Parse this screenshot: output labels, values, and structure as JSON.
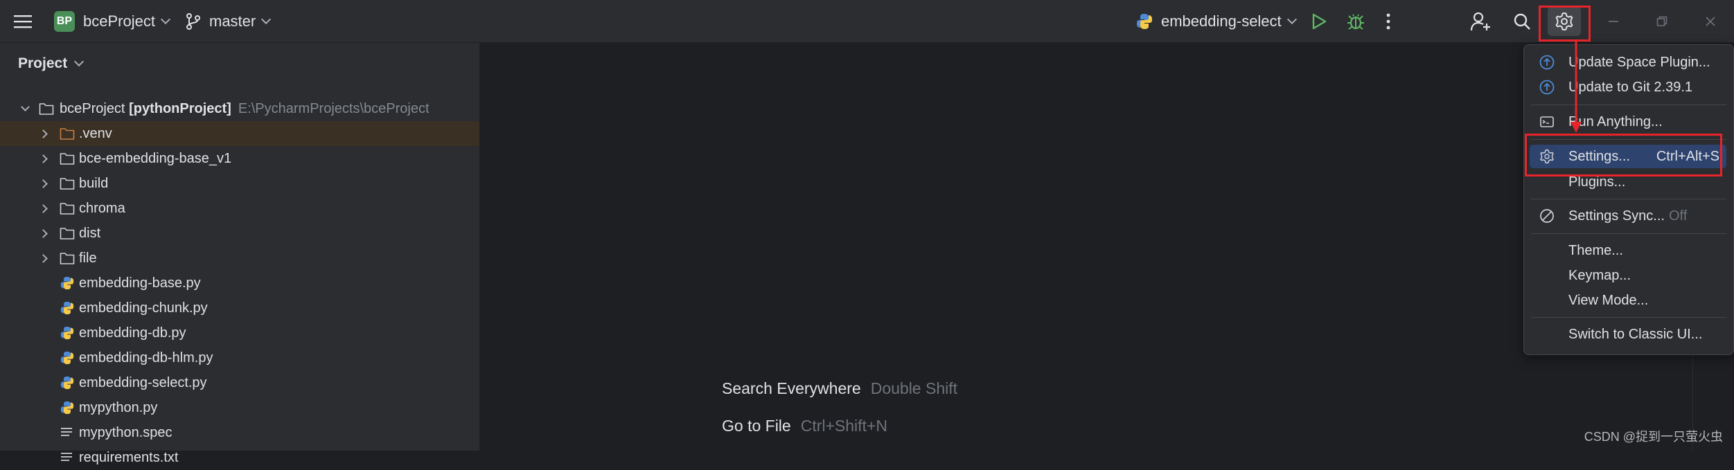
{
  "titlebar": {
    "project_badge": "BP",
    "project_name": "bceProject",
    "branch": "master",
    "run_config": "embedding-select"
  },
  "project_panel": {
    "header": "Project",
    "root": {
      "name": "bceProject",
      "module": "[pythonProject]",
      "path": "E:\\PycharmProjects\\bceProject"
    },
    "items": [
      {
        "label": ".venv",
        "kind": "folder-excluded"
      },
      {
        "label": "bce-embedding-base_v1",
        "kind": "folder"
      },
      {
        "label": "build",
        "kind": "folder"
      },
      {
        "label": "chroma",
        "kind": "folder"
      },
      {
        "label": "dist",
        "kind": "folder"
      },
      {
        "label": "file",
        "kind": "folder"
      },
      {
        "label": "embedding-base.py",
        "kind": "python"
      },
      {
        "label": "embedding-chunk.py",
        "kind": "python"
      },
      {
        "label": "embedding-db.py",
        "kind": "python"
      },
      {
        "label": "embedding-db-hlm.py",
        "kind": "python"
      },
      {
        "label": "embedding-select.py",
        "kind": "python"
      },
      {
        "label": "mypython.py",
        "kind": "python"
      },
      {
        "label": "mypython.spec",
        "kind": "text"
      },
      {
        "label": "requirements.txt",
        "kind": "text"
      }
    ]
  },
  "editor": {
    "hints": [
      {
        "action": "Search Everywhere",
        "shortcut": "Double Shift"
      },
      {
        "action": "Go to File",
        "shortcut": "Ctrl+Shift+N"
      }
    ]
  },
  "menu": {
    "items": [
      {
        "label": "Update Space Plugin...",
        "icon": "update-icon"
      },
      {
        "label": "Update to Git 2.39.1",
        "icon": "update-icon"
      },
      {
        "label": "Run Anything...",
        "icon": "run-anything-icon"
      },
      {
        "label": "Settings...",
        "shortcut": "Ctrl+Alt+S",
        "icon": "gear-icon"
      },
      {
        "label": "Plugins..."
      },
      {
        "label": "Settings Sync...",
        "suffix": "Off",
        "icon": "sync-off-icon"
      },
      {
        "label": "Theme..."
      },
      {
        "label": "Keymap..."
      },
      {
        "label": "View Mode..."
      },
      {
        "label": "Switch to Classic UI..."
      }
    ]
  },
  "watermark": "CSDN @捉到一只萤火虫",
  "colors": {
    "accent": "#2e436e",
    "annotation_red": "#e8242b",
    "run_green": "#5fb865",
    "badge_green": "#4a8e58"
  }
}
